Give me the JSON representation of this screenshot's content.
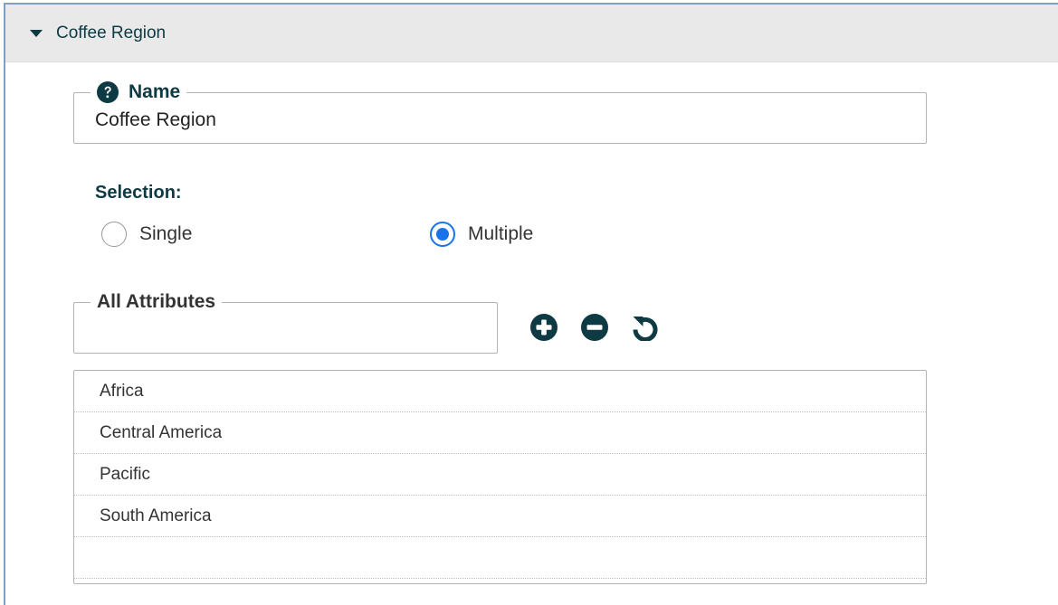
{
  "section": {
    "title": "Coffee Region",
    "caret_icon": "caret-down-icon"
  },
  "name_field": {
    "legend": "Name",
    "value": "Coffee Region",
    "help_icon": "question-circle-icon"
  },
  "selection": {
    "label": "Selection:",
    "options": [
      {
        "label": "Single",
        "checked": false
      },
      {
        "label": "Multiple",
        "checked": true
      }
    ]
  },
  "attributes": {
    "legend": "All Attributes",
    "value": "",
    "tools": [
      {
        "name": "add-icon",
        "label": "Add"
      },
      {
        "name": "remove-icon",
        "label": "Remove"
      },
      {
        "name": "reset-icon",
        "label": "Reset"
      }
    ],
    "items": [
      "Africa",
      "Central America",
      "Pacific",
      "South America",
      ""
    ]
  },
  "colors": {
    "accent": "#1a73e8",
    "heading": "#0e3a44",
    "header_bg": "#e9e9e9",
    "frame": "#7f9fc4"
  }
}
